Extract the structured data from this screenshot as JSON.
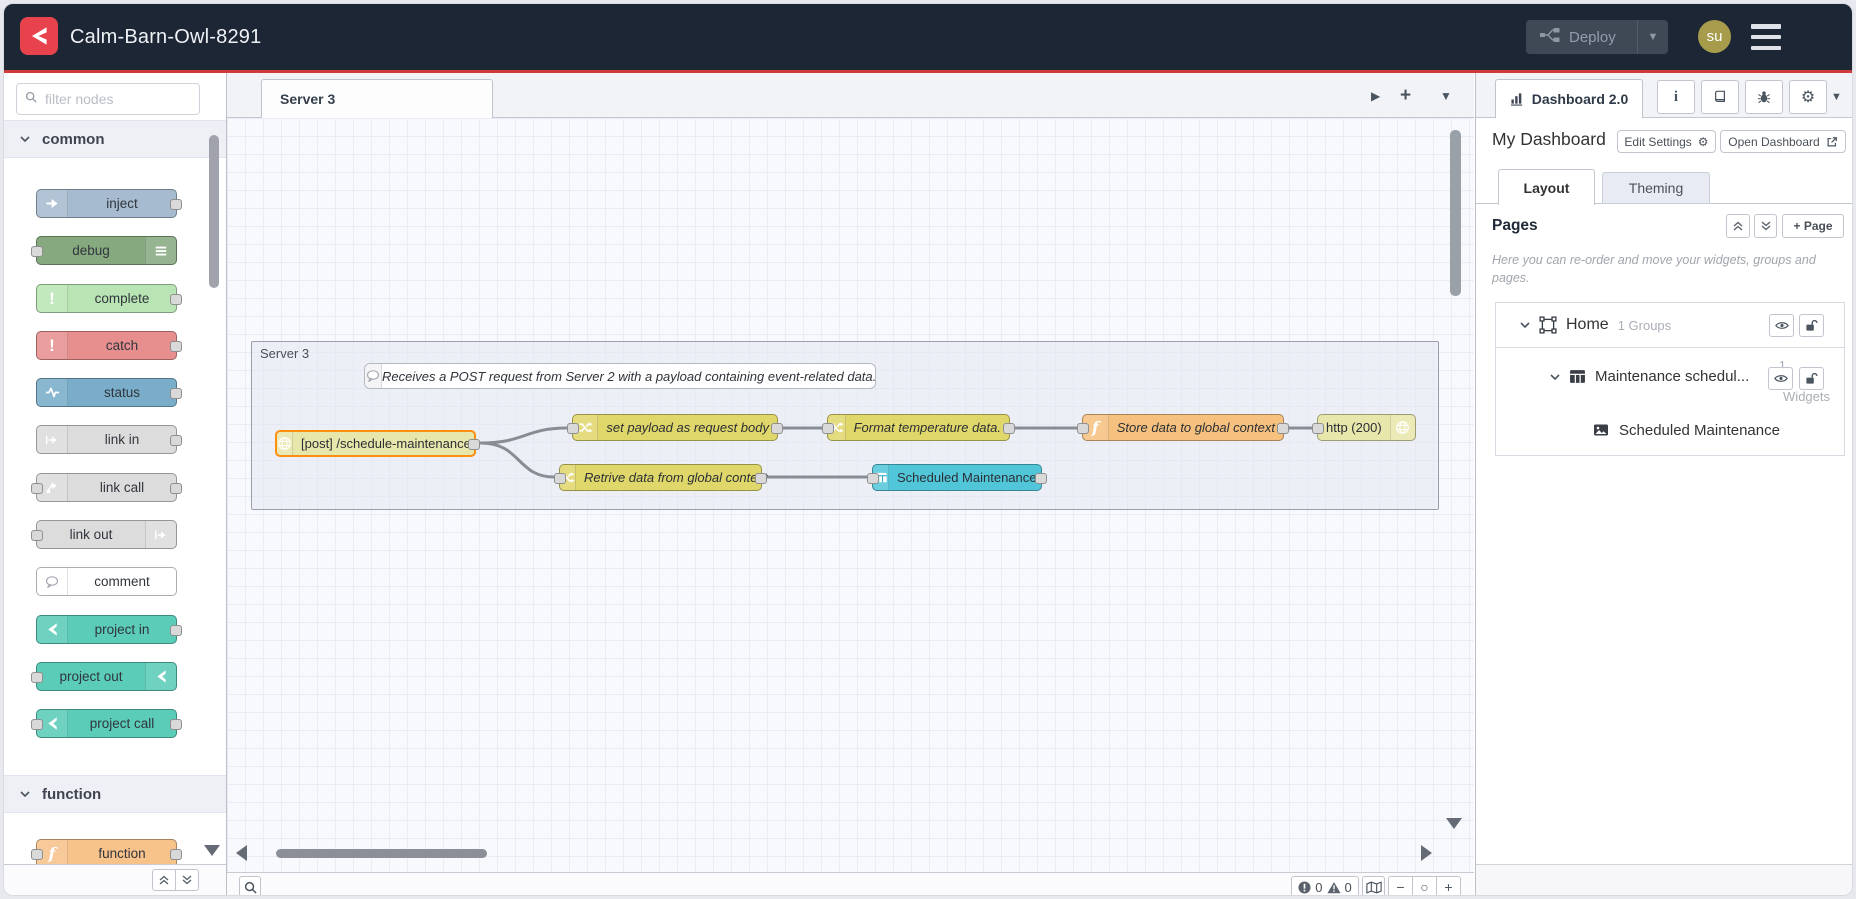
{
  "header": {
    "title": "Calm-Barn-Owl-8291",
    "deploy_label": "Deploy",
    "avatar_initials": "su"
  },
  "palette": {
    "filter_placeholder": "filter nodes",
    "categories": [
      {
        "label": "common",
        "nodes": [
          "inject",
          "debug",
          "complete",
          "catch",
          "status",
          "link in",
          "link call",
          "link out",
          "comment",
          "project in",
          "project out",
          "project call"
        ]
      },
      {
        "label": "function",
        "nodes": [
          "function"
        ]
      }
    ]
  },
  "workspace": {
    "tab": "Server 3",
    "group_label": "Server 3",
    "comment": "Receives a POST request from Server 2 with a payload containing event-related data.",
    "nodes": [
      {
        "label": "[post] /schedule-maintenance"
      },
      {
        "label": "set payload as request body"
      },
      {
        "label": "Format temperature data."
      },
      {
        "label": "Store data to global context"
      },
      {
        "label": "http (200)"
      },
      {
        "label": "Retrive data from global context"
      },
      {
        "label": "Scheduled Maintenance"
      }
    ]
  },
  "right_panel": {
    "tab": "Dashboard 2.0",
    "dashboard_title": "My Dashboard",
    "edit_settings": "Edit Settings",
    "open_dashboard": "Open Dashboard",
    "tabs": {
      "layout": "Layout",
      "theming": "Theming"
    },
    "pages_title": "Pages",
    "add_page": "+ Page",
    "help": "Here you can re-order and move your widgets, groups and pages.",
    "tree": {
      "home": {
        "label": "Home",
        "meta": "1 Groups"
      },
      "group": {
        "label": "Maintenance schedul...",
        "count": "1",
        "unit": "Widgets"
      },
      "widget": {
        "label": "Scheduled Maintenance"
      }
    }
  },
  "footer": {
    "errors": "0",
    "warnings": "0"
  },
  "colors": {
    "header_bg": "#1d2635",
    "accent_red": "#cf3a3a",
    "logo_red": "#e8434c",
    "node_inject": "#a6bbcf",
    "node_debug": "#87a980",
    "node_complete": "#b9e5b4",
    "node_catch": "#e78f8f",
    "node_status": "#79adc9",
    "node_link": "#dcdcdc",
    "node_comment": "#ffffff",
    "node_project": "#5accb8",
    "node_function": "#f6c17e",
    "node_change": "#e0d76b",
    "node_http": "#e8e7ab",
    "node_table": "#52c6d9",
    "selected_node": "#ff8f0f"
  }
}
